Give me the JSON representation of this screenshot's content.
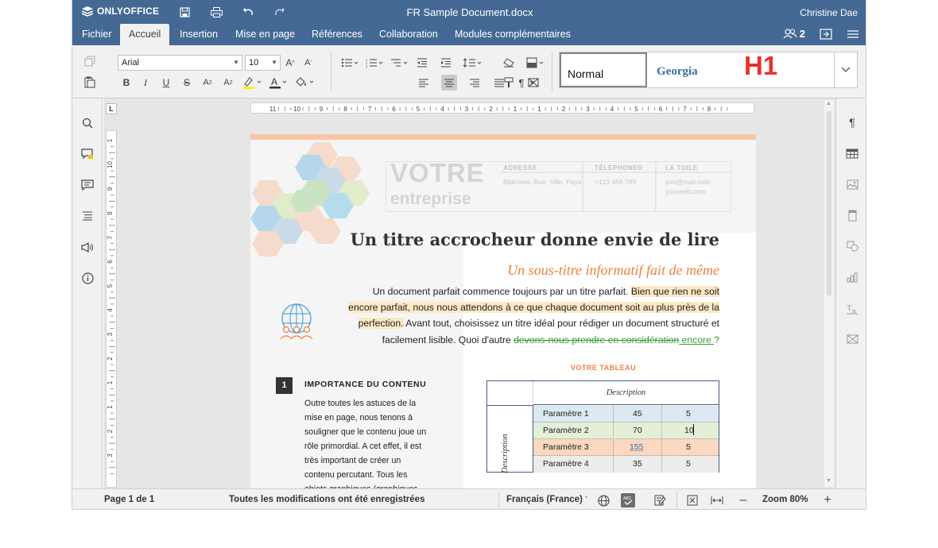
{
  "app": {
    "logo_text": "ONLYOFFICE",
    "doc_title": "FR Sample Document.docx",
    "user_name": "Christine Dae",
    "user_count": "2"
  },
  "menu": {
    "tabs": [
      "Fichier",
      "Accueil",
      "Insertion",
      "Mise en page",
      "Références",
      "Collaboration",
      "Modules complémentaires"
    ],
    "active": "Accueil"
  },
  "toolbar": {
    "font_name": "Arial",
    "font_size": "10",
    "styles": [
      "Normal",
      "Georgia",
      "H1"
    ]
  },
  "ruler": {
    "h_marks": [
      "11",
      "10",
      "9",
      "8",
      "7",
      "6",
      "5",
      "4",
      "3",
      "2",
      "1",
      "1",
      "2",
      "3",
      "4",
      "5",
      "6",
      "7",
      "8"
    ],
    "v_marks": [
      "1",
      "10",
      "9",
      "8",
      "7",
      "6",
      "5",
      "4",
      "3",
      "2",
      "1",
      "1",
      "2",
      "3"
    ]
  },
  "document": {
    "logo_big": "VOTRE",
    "logo_small": "entreprise",
    "contacts": [
      {
        "label": "ADRESSE",
        "value": "Bâtiment, Rue, Ville, Pays"
      },
      {
        "label": "TÉLÉPHONER",
        "value": "+123 456 789"
      },
      {
        "label": "LA TOILE",
        "value": "you@mail.com yourweb.com"
      }
    ],
    "title": "Un titre accrocheur donne envie de lire",
    "subtitle": "Un sous-titre informatif fait de même",
    "para_lines": [
      {
        "plain": "Un document parfait commence toujours par un titre parfait. ",
        "hl": "Bien que rien ne soit"
      },
      {
        "hl": "encore parfait, nous nous attendons à ce que chaque document soit au plus près de la"
      },
      {
        "hl": "perfection.",
        "plain": " Avant tout, choisissez un titre idéal pour rédiger un document structuré et"
      },
      {
        "plain": "facilement lisible. Quoi d'autre ",
        "del": "devons-nous prendre en considération",
        "ins": " encore ",
        "end": "?"
      }
    ],
    "section_number": "1",
    "section_title": "IMPORTANCE DU CONTENU",
    "section_lines": [
      "Outre toutes les astuces de la",
      "mise en page, nous tenons à",
      "souligner que le contenu joue un",
      "rôle primordial. A cet effet, il est",
      "très important de créer un",
      "contenu percutant. Tous les",
      "objets graphiques (graphiques"
    ],
    "table_title": "VOTRE TABLEAU",
    "table_header": "Description",
    "table_side": "Description",
    "table_rows": [
      {
        "label": "Paramètre 1",
        "a": "45",
        "b": "5"
      },
      {
        "label": "Paramètre 2",
        "a": "70",
        "b": "10"
      },
      {
        "label": "Paramètre 3",
        "a": "155",
        "b": "5"
      },
      {
        "label": "Paramètre 4",
        "a": "35",
        "b": "5"
      }
    ]
  },
  "status": {
    "page": "Page 1 de 1",
    "saved": "Toutes les modifications ont été enregistrées",
    "language": "Français (France)",
    "zoom": "Zoom 80%"
  },
  "colors": {
    "brand_bar": "#446995",
    "accent_orange": "#f07f3c",
    "highlight": "#fde8c5",
    "track_green": "#3a9c3a",
    "h1_red": "#e8312a"
  }
}
